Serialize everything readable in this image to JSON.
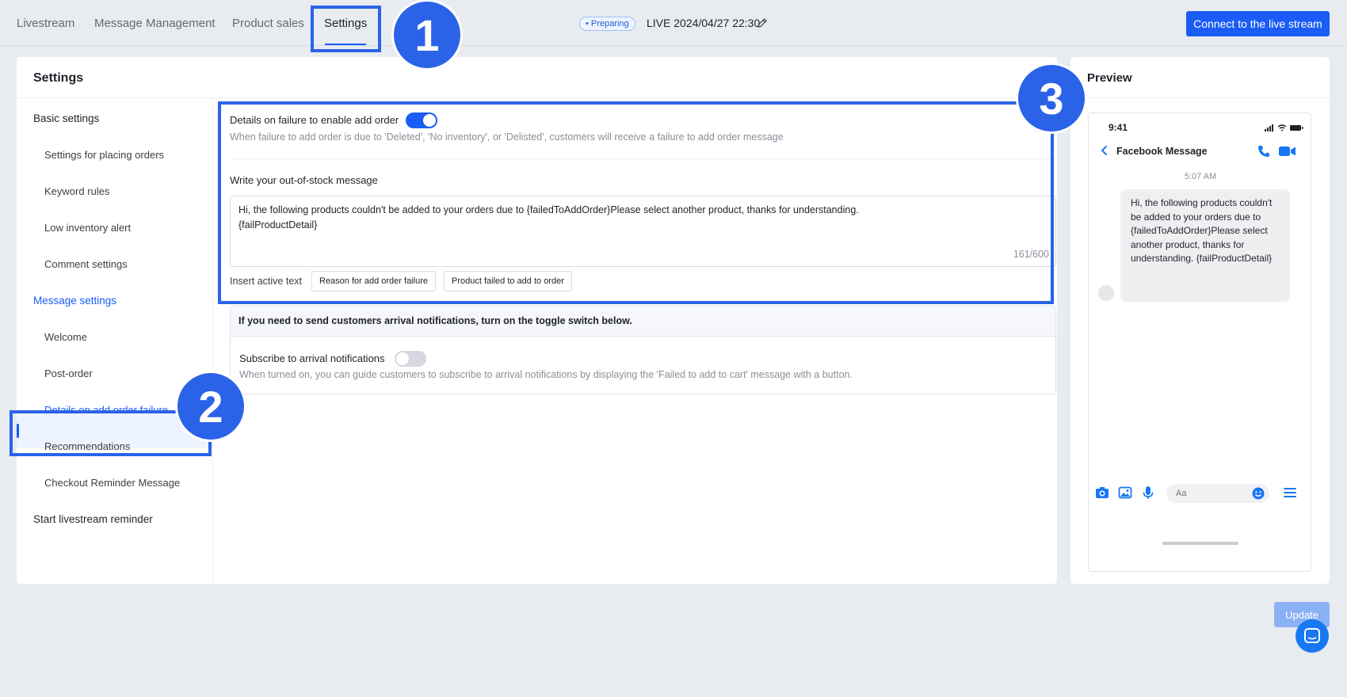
{
  "nav": {
    "tabs": [
      "Livestream",
      "Message Management",
      "Product sales",
      "Settings"
    ],
    "status_badge": "• Preparing",
    "live_label": "LIVE 2024/04/27 22:30",
    "connect_button": "Connect to the live stream"
  },
  "markers": [
    "1",
    "2",
    "3"
  ],
  "settings": {
    "title": "Settings",
    "sidebar": {
      "basic_group": "Basic settings",
      "basic_items": [
        "Settings for placing orders",
        "Keyword rules",
        "Low inventory alert",
        "Comment settings"
      ],
      "message_group": "Message settings",
      "message_items": [
        "Welcome",
        "Post-order",
        "Details on add order failure",
        "Recommendations",
        "Checkout Reminder Message"
      ],
      "reminder_group": "Start livestream reminder"
    },
    "failure_section": {
      "title": "Details on failure to enable add order",
      "toggle_on": true,
      "description": "When failure to add order is due to 'Deleted', 'No inventory', or 'Delisted', customers will receive a failure to add order message"
    },
    "out_of_stock": {
      "label": "Write your out-of-stock message",
      "message": "Hi, the following products couldn't be added to your orders due to {failedToAddOrder}Please select another product, thanks for understanding.\n{failProductDetail}",
      "counter": "161/600",
      "insert_label": "Insert active text",
      "chips": [
        "Reason for add order failure",
        "Product failed to add to order"
      ]
    },
    "arrival": {
      "notice": "If you need to send customers arrival notifications, turn on the toggle switch below.",
      "title": "Subscribe to arrival notifications",
      "toggle_on": false,
      "description": "When turned on, you can guide customers to subscribe to arrival notifications by displaying the 'Failed to add to cart' message with a button."
    }
  },
  "preview": {
    "title": "Preview",
    "time": "9:41",
    "chat_name": "Facebook Message",
    "timestamp": "5:07 AM",
    "bubble": "Hi, the following products couldn't be added to your orders due to {failedToAddOrder}Please select another product, thanks for understanding. {failProductDetail}",
    "input_placeholder": "Aa",
    "icons": [
      "back-arrow-icon",
      "phone-icon",
      "video-icon",
      "camera-icon",
      "image-icon",
      "mic-icon",
      "emoji-icon",
      "menu-icon"
    ]
  },
  "update_button": "Update",
  "colors": {
    "accent": "#1a5cf5",
    "highlight": "#2b63e8",
    "fab": "#1877f2"
  }
}
